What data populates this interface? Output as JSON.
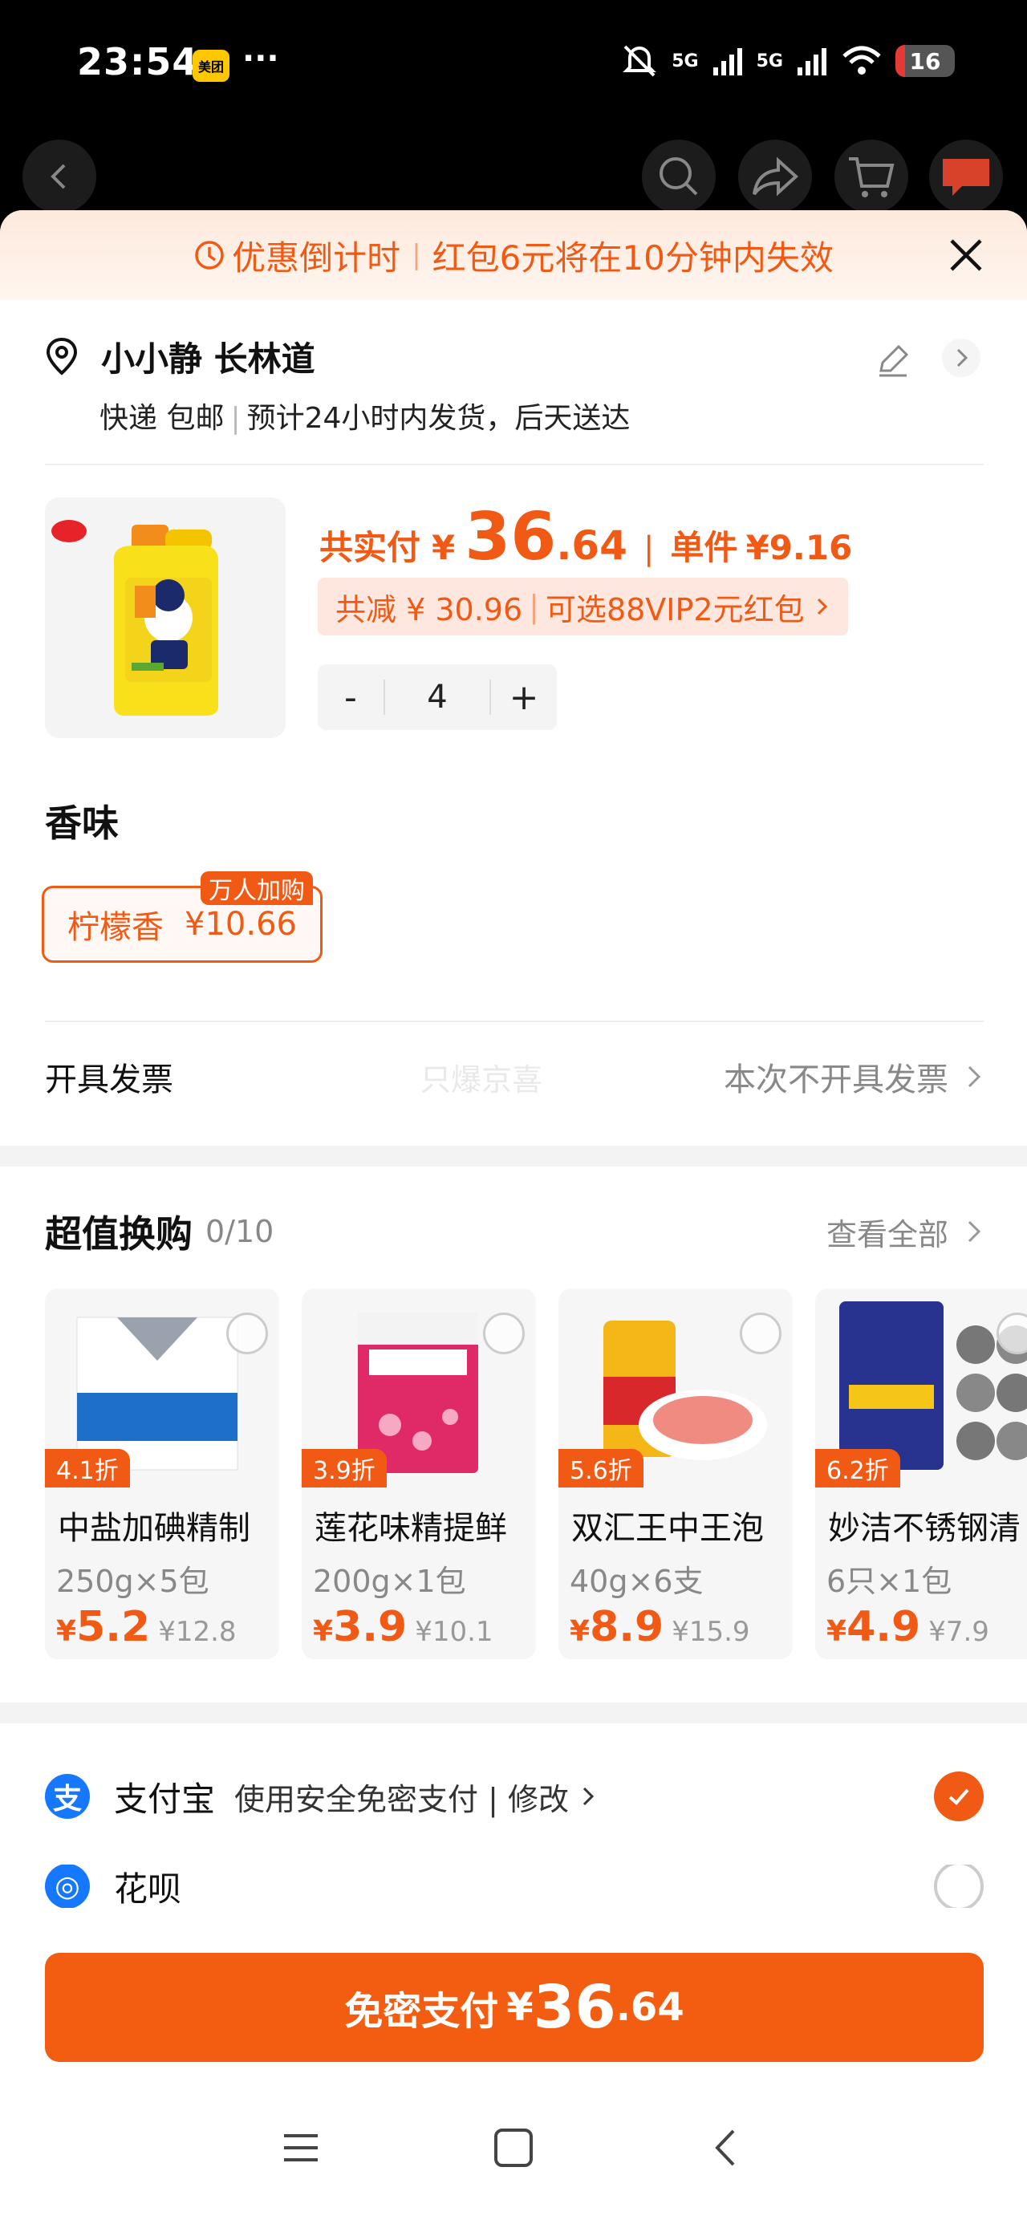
{
  "status_bar": {
    "time": "23:54",
    "app_badge": "美团",
    "more": "···",
    "signal_1": "5G",
    "signal_2": "5G",
    "battery": "16",
    "battery_level": 0.16
  },
  "countdown": {
    "label": "优惠倒计时",
    "message": "红包6元将在10分钟内失效"
  },
  "address": {
    "name": "小小静 长林道",
    "delivery": "快递 包邮",
    "eta": "预计24小时内发货，后天送达"
  },
  "product": {
    "total_label": "共实付",
    "currency": "¥",
    "total_int": "36",
    "total_dec": ".64",
    "unit_label": "单件",
    "unit_price": "¥9.16",
    "discount_text": "共减 ¥ 30.96",
    "vip_text": "可选88VIP2元红包",
    "quantity": "4",
    "minus": "-",
    "plus": "+"
  },
  "flavor": {
    "title": "香味",
    "option_name": "柠檬香",
    "option_price": "¥10.66",
    "badge": "万人加购"
  },
  "invoice": {
    "label": "开具发票",
    "watermark": "只爆京喜",
    "value": "本次不开具发票"
  },
  "swap": {
    "title": "超值换购",
    "count": "0/10",
    "view_all": "查看全部",
    "items": [
      {
        "discount": "4.1折",
        "name": "中盐加碘精制",
        "spec": "250g×5包",
        "yen": "¥",
        "price": "5.2",
        "orig": "¥12.8"
      },
      {
        "discount": "3.9折",
        "name": "莲花味精提鲜",
        "spec": "200g×1包",
        "yen": "¥",
        "price": "3.9",
        "orig": "¥10.1"
      },
      {
        "discount": "5.6折",
        "name": "双汇王中王泡",
        "spec": "40g×6支",
        "yen": "¥",
        "price": "8.9",
        "orig": "¥15.9"
      },
      {
        "discount": "6.2折",
        "name": "妙洁不锈钢清",
        "spec": "6只×1包",
        "yen": "¥",
        "price": "4.9",
        "orig": "¥7.9"
      }
    ]
  },
  "payment": {
    "alipay_name": "支付宝",
    "alipay_desc": "使用安全免密支付 | 修改",
    "huabei_name": "花呗",
    "button_label": "免密支付",
    "button_currency": "¥",
    "button_int": "36",
    "button_dec": ".64"
  },
  "colors": {
    "accent": "#f05a14",
    "alipay_blue": "#1677ff"
  }
}
